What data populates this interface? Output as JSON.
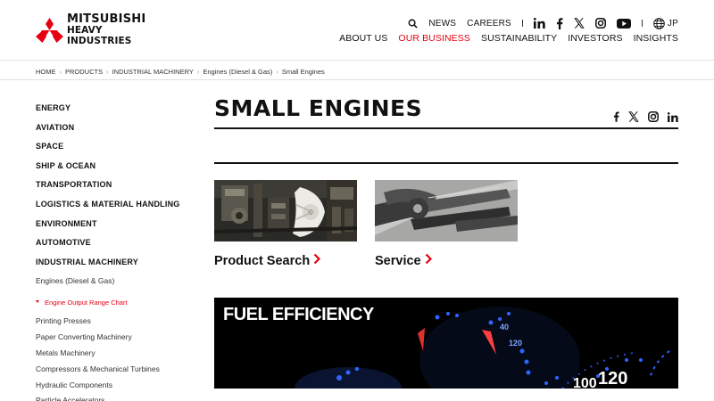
{
  "brand": {
    "name_line1": "MITSUBISHI",
    "name_line2": "HEAVY INDUSTRIES",
    "color": "#e60012"
  },
  "utility": {
    "news": "NEWS",
    "careers": "CAREERS",
    "language": "JP",
    "icons": [
      "search-icon",
      "linkedin-icon",
      "facebook-icon",
      "x-icon",
      "instagram-icon",
      "youtube-icon",
      "globe-icon"
    ]
  },
  "nav": {
    "items": [
      "ABOUT US",
      "OUR BUSINESS",
      "SUSTAINABILITY",
      "INVESTORS",
      "INSIGHTS"
    ],
    "active": "OUR BUSINESS"
  },
  "breadcrumb": [
    "HOME",
    "PRODUCTS",
    "INDUSTRIAL MACHINERY",
    "Engines (Diesel & Gas)",
    "Small Engines"
  ],
  "sidebar": {
    "top_items": [
      "ENERGY",
      "AVIATION",
      "SPACE",
      "SHIP & OCEAN",
      "TRANSPORTATION",
      "LOGISTICS & MATERIAL HANDLING",
      "ENVIRONMENT",
      "AUTOMOTIVE",
      "INDUSTRIAL MACHINERY"
    ],
    "sub_item": "Engines (Diesel & Gas)",
    "sub_sub_item": "Engine Output Range Chart",
    "lower_items": [
      "Printing Presses",
      "Paper Converting Machinery",
      "Metals Machinery",
      "Compressors & Mechanical Turbines",
      "Hydraulic Components",
      "Particle Accelerators"
    ]
  },
  "page": {
    "title": "SMALL ENGINES",
    "share_icons": [
      "facebook-icon",
      "x-icon",
      "instagram-icon",
      "linkedin-icon"
    ]
  },
  "cards": [
    {
      "label": "Product Search",
      "image": "engine-photo"
    },
    {
      "label": "Service",
      "image": "wrench-photo"
    }
  ],
  "banner": {
    "title": "FUEL EFFICIENCY",
    "gauge_numbers": [
      "100",
      "120"
    ]
  },
  "colors": {
    "accent": "#e60012",
    "text": "#111111",
    "rule": "#111111"
  }
}
